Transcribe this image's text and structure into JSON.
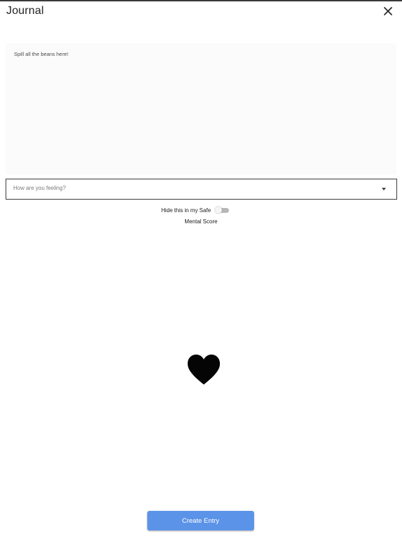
{
  "header": {
    "title": "Journal",
    "close_icon": "close-icon"
  },
  "entry": {
    "placeholder": "Spill all the beans here!",
    "value": ""
  },
  "feeling": {
    "placeholder": "How are you feeling?",
    "arrow_icon": "dropdown-arrow-icon"
  },
  "safe": {
    "label": "Hide this in my Safe",
    "enabled": false
  },
  "mental_score": {
    "label": "Mental Score",
    "icon": "heart-icon"
  },
  "actions": {
    "create_label": "Create Entry"
  },
  "colors": {
    "primary_button": "#5b93e8",
    "text": "#1a1a1a",
    "border": "#3c3c3c"
  }
}
